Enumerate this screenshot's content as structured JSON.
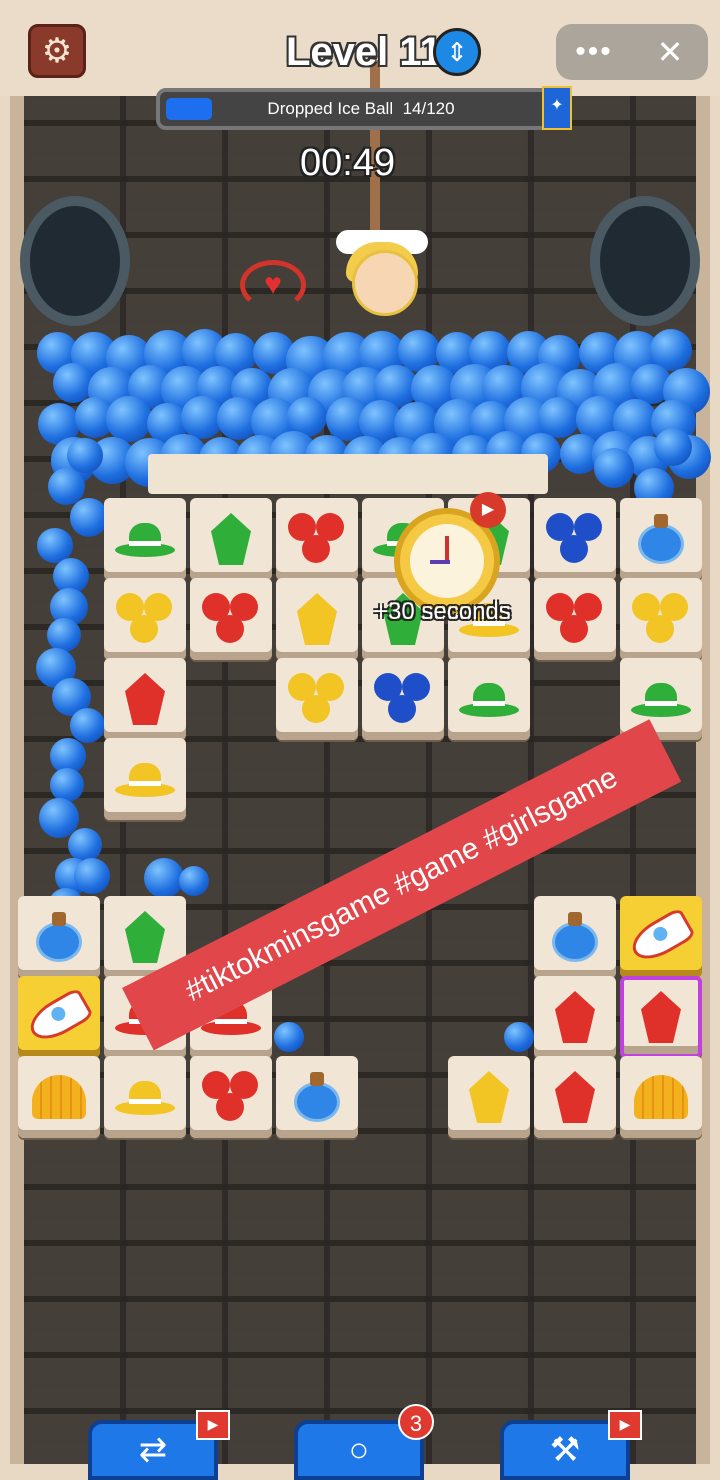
{
  "header": {
    "level_label": "Level 11",
    "level_icon": "swap-vertical-icon",
    "settings_icon": "gear-icon"
  },
  "window_controls": {
    "more_label": "•••",
    "close_label": "✕"
  },
  "progress": {
    "label": "Dropped Ice Ball",
    "count_text": "14/120",
    "current": 14,
    "total": 120,
    "fraction": 0.117,
    "badge_icon": "star-icon"
  },
  "timer": {
    "value": "00:49"
  },
  "bonus": {
    "label": "+30 seconds",
    "icon": "stopwatch-icon",
    "badge_icon": "video-icon"
  },
  "banner": {
    "text": "#tiktokminsgame #game #girlsgame"
  },
  "bottom_bar": {
    "shuffle_icon": "shuffle-icon",
    "hint_icon": "magnifier-icon",
    "hint_count": "3",
    "hammer_icon": "hammer-icon",
    "video_icon": "video-icon"
  },
  "colors": {
    "ball": "#1f6fe0",
    "banner": "#e0464a",
    "tile": "#f1e6d6",
    "gold_tile": "#f6cf35"
  }
}
